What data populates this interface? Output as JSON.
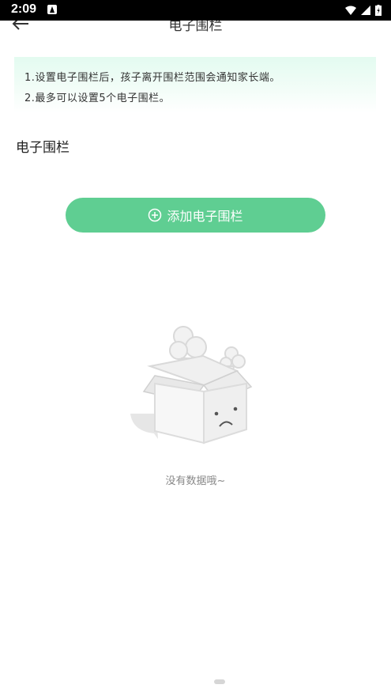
{
  "status_bar": {
    "time": "2:09"
  },
  "header": {
    "title": "电子围栏"
  },
  "tips": [
    "1.设置电子围栏后，孩子离开围栏范围会通知家长端。",
    "2.最多可以设置5个电子围栏。"
  ],
  "section": {
    "title": "电子围栏"
  },
  "add_button": {
    "label": "添加电子围栏"
  },
  "empty_state": {
    "text": "没有数据哦~"
  },
  "colors": {
    "accent": "#5fce92",
    "tips_bg": "#e3fbf0"
  }
}
